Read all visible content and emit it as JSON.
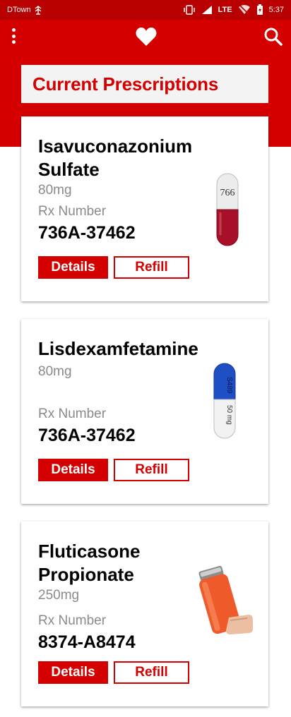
{
  "status_bar": {
    "carrier": "DTown",
    "network": "LTE",
    "time": "5:37"
  },
  "header": {
    "menu_icon": "more-vert-icon",
    "logo_icon": "heart-icon",
    "search_icon": "search-icon"
  },
  "page_title": "Current Prescriptions",
  "colors": {
    "brand_red": "#d40000",
    "status_bar": "#b80000",
    "secondary_text": "#8a8a8a"
  },
  "prescriptions": [
    {
      "name": "Isavuconazonium Sulfate",
      "dose": "80mg",
      "rx_label": "Rx Number",
      "rx_number": "736A-37462",
      "details_label": "Details",
      "refill_label": "Refill",
      "image": "red-white-capsule",
      "imprint": "766"
    },
    {
      "name": "Lisdexamfetamine",
      "dose": "80mg",
      "rx_label": "Rx Number",
      "rx_number": "736A-37462",
      "details_label": "Details",
      "refill_label": "Refill",
      "image": "blue-white-capsule",
      "imprint_top": "S489",
      "imprint_bottom": "50 mg"
    },
    {
      "name": "Fluticasone Propionate",
      "dose": "250mg",
      "rx_label": "Rx Number",
      "rx_number": "8374-A8474",
      "details_label": "Details",
      "refill_label": "Refill",
      "image": "inhaler"
    }
  ]
}
